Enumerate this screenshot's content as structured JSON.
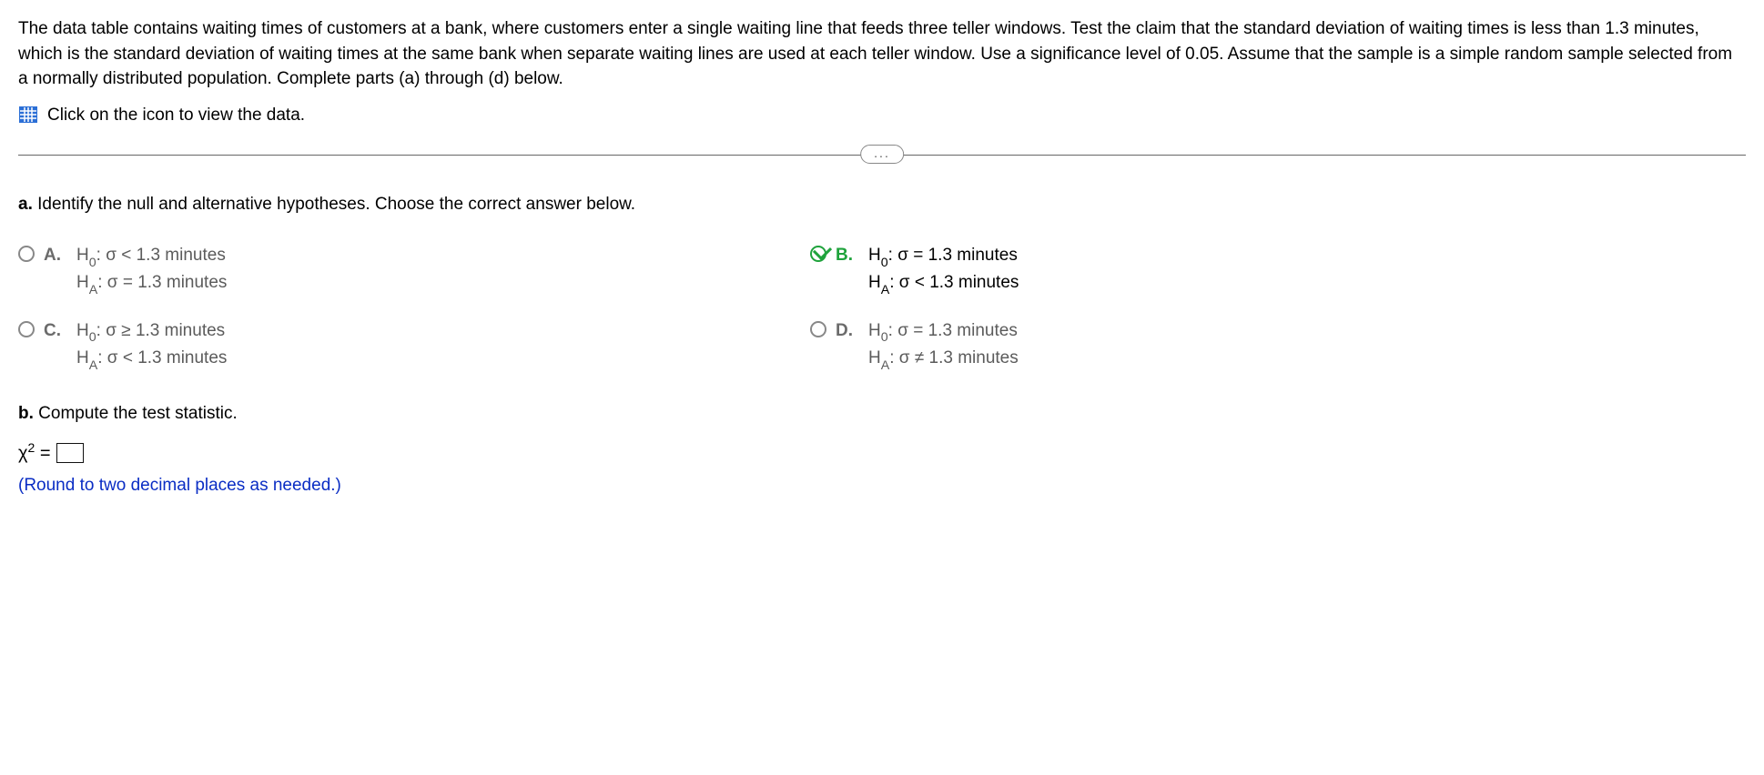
{
  "intro": "The data table contains waiting times of customers at a bank, where customers enter a single waiting line that feeds three teller windows. Test the claim that the standard deviation of waiting times is less than 1.3 minutes, which is the standard deviation of waiting times at the same bank when separate waiting lines are used at each teller window. Use a significance level of 0.05. Assume that the sample is a simple random sample selected from a normally distributed population. Complete parts (a) through (d) below.",
  "iconLink": "Click on the icon to view the data.",
  "ellipsis": "...",
  "partA": {
    "letter": "a.",
    "prompt": "Identify the null and alternative hypotheses. Choose the correct answer below.",
    "options": {
      "A": {
        "letter": "A.",
        "h0_prefix": "H",
        "h0_sub": "0",
        "h0_rest": ": σ < 1.3 minutes",
        "ha_prefix": "H",
        "ha_sub": "A",
        "ha_rest": ": σ = 1.3 minutes"
      },
      "B": {
        "letter": "B.",
        "h0_prefix": "H",
        "h0_sub": "0",
        "h0_rest": ": σ = 1.3 minutes",
        "ha_prefix": "H",
        "ha_sub": "A",
        "ha_rest": ": σ < 1.3 minutes"
      },
      "C": {
        "letter": "C.",
        "h0_prefix": "H",
        "h0_sub": "0",
        "h0_rest": ": σ ≥ 1.3 minutes",
        "ha_prefix": "H",
        "ha_sub": "A",
        "ha_rest": ": σ < 1.3 minutes"
      },
      "D": {
        "letter": "D.",
        "h0_prefix": "H",
        "h0_sub": "0",
        "h0_rest": ": σ = 1.3 minutes",
        "ha_prefix": "H",
        "ha_sub": "A",
        "ha_rest": ": σ ≠ 1.3 minutes"
      }
    }
  },
  "partB": {
    "letter": "b.",
    "prompt": "Compute the test statistic.",
    "chi": "χ",
    "sup": "2",
    "equals": " = ",
    "roundNote": "(Round to two decimal places as needed.)"
  }
}
